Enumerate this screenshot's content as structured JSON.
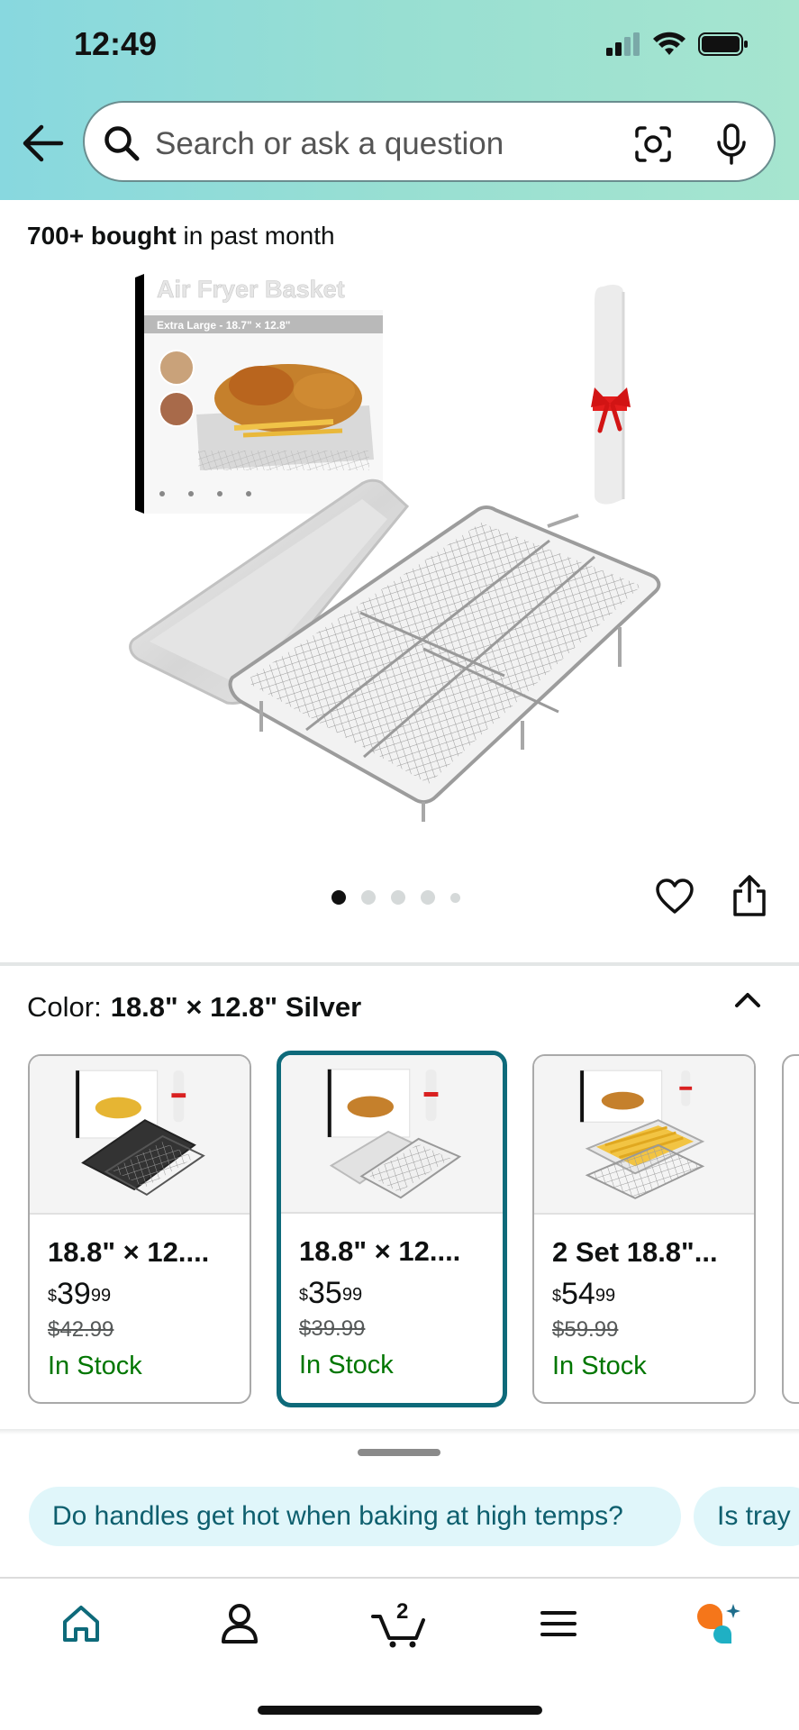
{
  "status_bar": {
    "time": "12:49"
  },
  "search": {
    "placeholder": "Search or ask a question"
  },
  "product": {
    "bought_count": "700+ bought",
    "bought_suffix": " in past month",
    "image_box_title": "Air Fryer Basket",
    "image_box_subtitle": "Extra Large - 18.7\" × 12.8\"",
    "image_count": 5,
    "active_image_index": 0
  },
  "color": {
    "label": "Color:",
    "value": "18.8\" × 12.8\" Silver"
  },
  "variants": [
    {
      "title": "18.8\" × 12....",
      "currency": "$",
      "price_whole": "39",
      "price_cents": "99",
      "list_price": "$42.99",
      "stock": "In Stock",
      "selected": false
    },
    {
      "title": "18.8\" × 12....",
      "currency": "$",
      "price_whole": "35",
      "price_cents": "99",
      "list_price": "$39.99",
      "stock": "In Stock",
      "selected": true
    },
    {
      "title": "2 Set 18.8\"...",
      "currency": "$",
      "price_whole": "54",
      "price_cents": "99",
      "list_price": "$59.99",
      "stock": "In Stock",
      "selected": false
    }
  ],
  "questions": [
    "Do handles get hot when baking at high temps?",
    "Is tray"
  ],
  "bottom_nav": {
    "cart_count": "2",
    "items": [
      "home-icon",
      "account-icon",
      "cart-icon",
      "menu-icon",
      "rufus-icon"
    ]
  },
  "colors": {
    "header_teal": "#98dfd2",
    "selected_border": "#0e6a7a",
    "in_stock_green": "#007600",
    "chip_bg": "#e0f6fa",
    "chip_text": "#0e5f6e",
    "rufus_orange": "#f5761a",
    "rufus_teal": "#1fb0c4"
  }
}
